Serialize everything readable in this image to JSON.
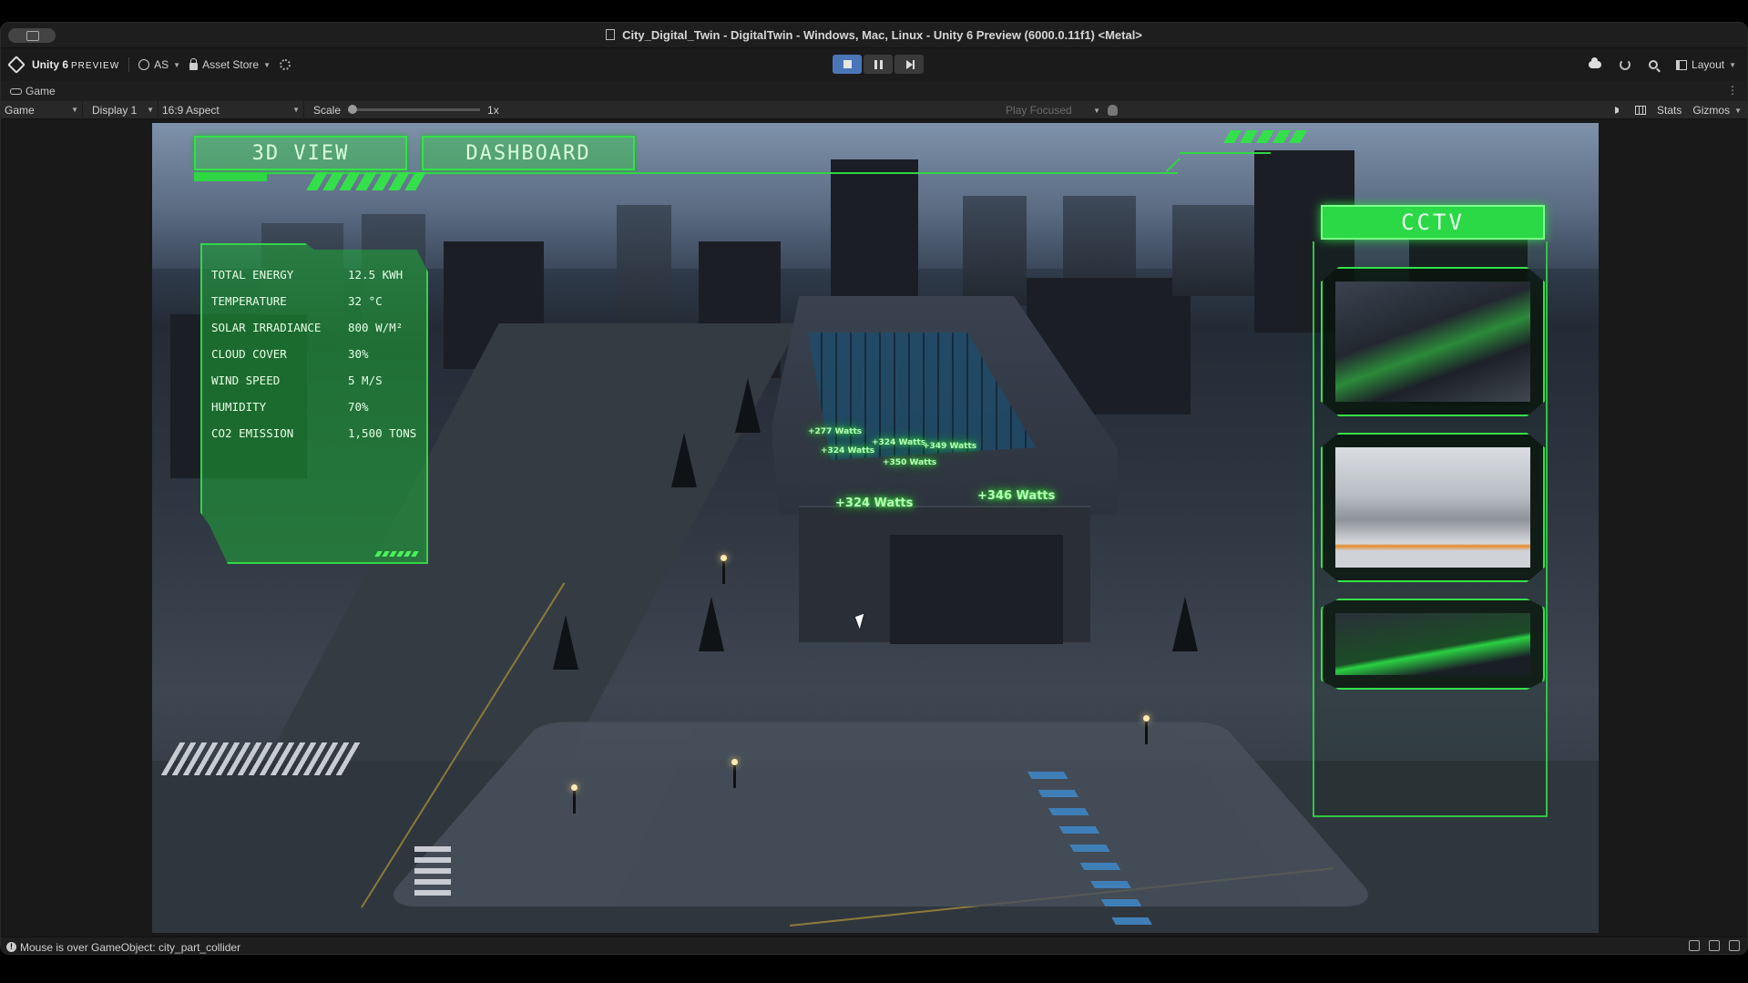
{
  "window": {
    "title": "City_Digital_Twin - DigitalTwin - Windows, Mac, Linux - Unity 6 Preview (6000.0.11f1) <Metal>"
  },
  "toolbar": {
    "brand": "Unity 6",
    "brand_suffix": "PREVIEW",
    "account": "AS",
    "asset_store": "Asset Store",
    "layout": "Layout"
  },
  "game_tab": {
    "label": "Game"
  },
  "game_controls": {
    "view_mode": "Game",
    "display": "Display 1",
    "aspect": "16:9 Aspect",
    "scale_label": "Scale",
    "scale_value": "1x",
    "play_focused": "Play Focused",
    "stats": "Stats",
    "gizmos": "Gizmos"
  },
  "hud": {
    "btn_3d": "3D VIEW",
    "btn_dashboard": "DASHBOARD",
    "cctv_title": "CCTV",
    "stats": [
      {
        "label": "TOTAL ENERGY",
        "value": "12.5 KWH"
      },
      {
        "label": "TEMPERATURE",
        "value": "32 °C"
      },
      {
        "label": "SOLAR IRRADIANCE",
        "value": "800 W/M²"
      },
      {
        "label": "CLOUD COVER",
        "value": "30%"
      },
      {
        "label": "WIND SPEED",
        "value": "5 M/S"
      },
      {
        "label": "HUMIDITY",
        "value": "70%"
      },
      {
        "label": "CO2 EMISSION",
        "value": "1,500 TONS"
      }
    ],
    "watt_labels": [
      "+277 Watts",
      "+324 Watts",
      "+324 Watts",
      "+349 Watts",
      "+350 Watts",
      "+324 Watts",
      "+346 Watts"
    ]
  },
  "status": {
    "message": "Mouse is over GameObject: city_part_collider"
  },
  "colors": {
    "hud_green": "#34e04a",
    "play_active": "#4a76b8"
  }
}
